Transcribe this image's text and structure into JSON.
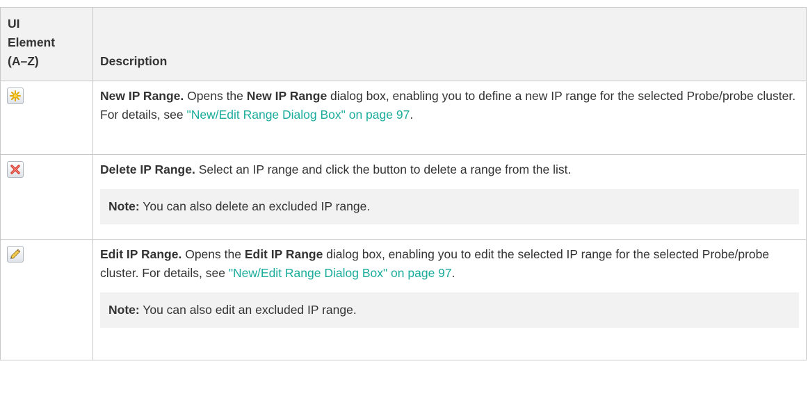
{
  "table": {
    "header": {
      "col1": "UI Element (A–Z)",
      "col1_lines": [
        "UI",
        "Element",
        "(A–Z)"
      ],
      "col2": "Description"
    },
    "rows": [
      {
        "icon": "new-star-icon",
        "title": "New IP Range.",
        "text_a": " Opens the ",
        "bold_b": "New IP Range",
        "text_c": " dialog box, enabling you to define a new IP range for the selected Probe/probe cluster. For details, see ",
        "link": "\"New/Edit Range Dialog Box\" on page 97",
        "text_end": ".",
        "note_label": "",
        "note_text": ""
      },
      {
        "icon": "delete-x-icon",
        "title": "Delete IP Range.",
        "text_a": " Select an IP range and click the button to delete a range from the list.",
        "note_label": "Note:",
        "note_text": " You can also delete an excluded IP range."
      },
      {
        "icon": "pencil-edit-icon",
        "title": "Edit IP Range.",
        "text_a": " Opens the ",
        "bold_b": "Edit IP Range",
        "text_c": " dialog box, enabling you to edit the selected IP range for the selected Probe/probe cluster. For details, see ",
        "link": "\"New/Edit Range Dialog Box\" on page 97",
        "text_end": ".",
        "note_label": "Note:",
        "note_text": " You can also edit an excluded IP range."
      }
    ]
  },
  "colors": {
    "link": "#1aac9b",
    "header_bg": "#f2f2f2",
    "note_bg": "#f2f2f2",
    "border": "#c8c8c8"
  }
}
